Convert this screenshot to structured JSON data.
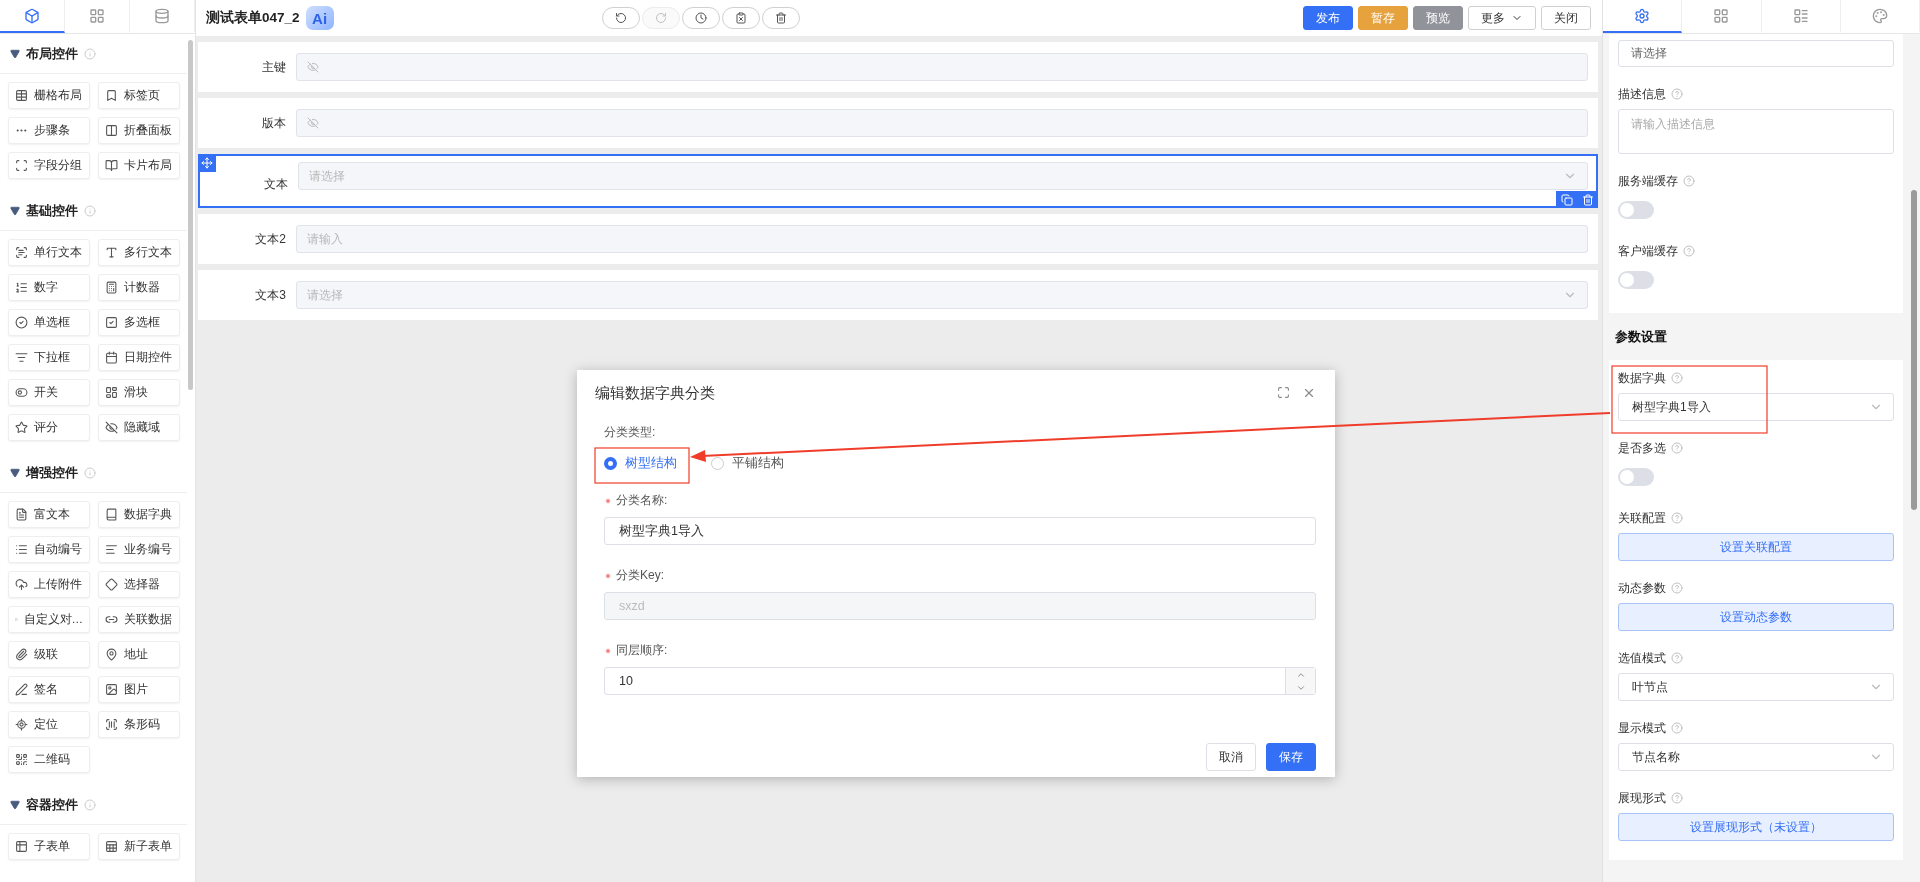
{
  "left_panel": {
    "tabs": [
      {
        "selected": true
      },
      {
        "selected": false
      },
      {
        "selected": false
      }
    ],
    "groups": [
      {
        "title": "布局控件",
        "items": [
          "栅格布局",
          "标签页",
          "步骤条",
          "折叠面板",
          "字段分组",
          "卡片布局"
        ]
      },
      {
        "title": "基础控件",
        "items": [
          "单行文本",
          "多行文本",
          "数字",
          "计数器",
          "单选框",
          "多选框",
          "下拉框",
          "日期控件",
          "开关",
          "滑块",
          "评分",
          "隐藏域"
        ]
      },
      {
        "title": "增强控件",
        "items": [
          "富文本",
          "数据字典",
          "自动编号",
          "业务编号",
          "上传附件",
          "选择器",
          "自定义对…",
          "关联数据",
          "级联",
          "地址",
          "签名",
          "图片",
          "定位",
          "条形码",
          "二维码"
        ]
      },
      {
        "title": "容器控件",
        "items": [
          "子表单",
          "新子表单"
        ]
      }
    ]
  },
  "toolbar": {
    "title": "测试表单047_2",
    "ai_badge": "Ai",
    "history_buttons": [
      {
        "disabled": false
      },
      {
        "disabled": true
      },
      {
        "disabled": false
      },
      {
        "disabled": false
      },
      {
        "disabled": false
      }
    ],
    "actions": [
      {
        "label": "发布",
        "kind": "primary"
      },
      {
        "label": "暂存",
        "kind": "warning"
      },
      {
        "label": "预览",
        "kind": "info"
      },
      {
        "label": "更多",
        "kind": "dropdown"
      },
      {
        "label": "关闭",
        "kind": "plain"
      }
    ]
  },
  "form_rows": [
    {
      "label": "主键",
      "kind": "hidden",
      "selected": false
    },
    {
      "label": "版本",
      "kind": "hidden",
      "selected": false
    },
    {
      "label": "文本",
      "kind": "select",
      "placeholder": "请选择",
      "selected": true
    },
    {
      "label": "文本2",
      "kind": "input",
      "placeholder": "请输入",
      "selected": false
    },
    {
      "label": "文本3",
      "kind": "select",
      "placeholder": "请选择",
      "selected": false
    }
  ],
  "dialog": {
    "title": "编辑数据字典分类",
    "type_label": "分类类型:",
    "type_options": [
      {
        "label": "树型结构",
        "selected": true
      },
      {
        "label": "平铺结构",
        "selected": false
      }
    ],
    "fields": [
      {
        "label": "分类名称:",
        "required": true,
        "kind": "input",
        "value": "树型字典1导入",
        "disabled": false
      },
      {
        "label": "分类Key:",
        "required": true,
        "kind": "input",
        "value": "sxzd",
        "disabled": true
      },
      {
        "label": "同层顺序:",
        "required": true,
        "kind": "number",
        "value": "10",
        "disabled": false
      }
    ],
    "buttons": [
      {
        "label": "取消",
        "kind": "plain"
      },
      {
        "label": "保存",
        "kind": "primary"
      }
    ]
  },
  "properties": {
    "tabs": [
      {
        "selected": true
      },
      {
        "selected": false
      },
      {
        "selected": false
      },
      {
        "selected": false
      }
    ],
    "top_field": {
      "placeholder": "请选择"
    },
    "basic": [
      {
        "kind": "textarea",
        "label": "描述信息",
        "placeholder": "请输入描述信息"
      },
      {
        "kind": "switch",
        "label": "服务端缓存",
        "on": false
      },
      {
        "kind": "switch",
        "label": "客户端缓存",
        "on": false
      }
    ],
    "section_title": "参数设置",
    "params": [
      {
        "kind": "select",
        "label": "数据字典",
        "value": "树型字典1导入"
      },
      {
        "kind": "switch",
        "label": "是否多选",
        "on": false
      },
      {
        "kind": "button",
        "label": "关联配置",
        "button": "设置关联配置"
      },
      {
        "kind": "button",
        "label": "动态参数",
        "button": "设置动态参数"
      },
      {
        "kind": "select",
        "label": "选值模式",
        "value": "叶节点"
      },
      {
        "kind": "select",
        "label": "显示模式",
        "value": "节点名称"
      },
      {
        "kind": "button",
        "label": "展现形式",
        "button": "设置展现形式（未设置）"
      }
    ]
  }
}
